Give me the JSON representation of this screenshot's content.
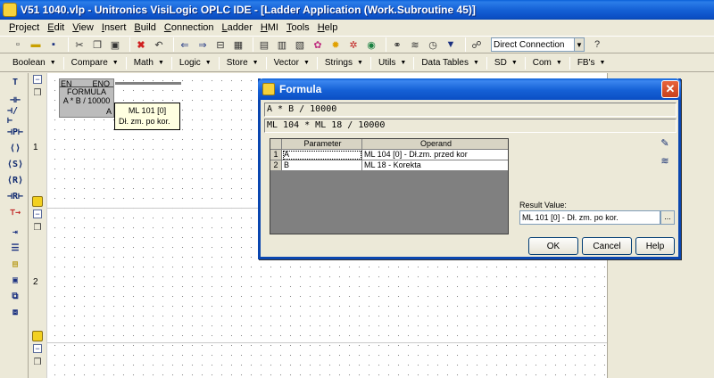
{
  "window": {
    "title": "V51 1040.vlp - Unitronics VisiLogic OPLC IDE - [Ladder Application (Work.Subroutine 45)]"
  },
  "menu": [
    "Project",
    "Edit",
    "View",
    "Insert",
    "Build",
    "Connection",
    "Ladder",
    "HMI",
    "Tools",
    "Help"
  ],
  "toolbar": {
    "connection": "Direct Connection"
  },
  "categories": [
    "Boolean",
    "Compare",
    "Math",
    "Logic",
    "Store",
    "Vector",
    "Strings",
    "Utils",
    "Data Tables",
    "SD",
    "Com",
    "FB's"
  ],
  "left_tools": [
    "T",
    "⊣⊢",
    "⊣/⊢",
    "⊣P⊢",
    "⟨⟩",
    "⟨S⟩",
    "⟨R⟩",
    "⊣R⊢",
    "⊤→"
  ],
  "rungs": {
    "one": "1",
    "two": "2"
  },
  "function_block": {
    "en": "EN",
    "eno": "ENO",
    "name": "FORMULA",
    "formula": "A * B / 10000",
    "output_label": "A"
  },
  "tooltip": {
    "line1": "ML 101 [0]",
    "line2": "Dł. zm. po kor."
  },
  "dialog": {
    "title": "Formula",
    "formula": "A * B / 10000",
    "resolved": "ML 104 * ML 18 / 10000",
    "grid_headers": {
      "parameter": "Parameter",
      "operand": "Operand"
    },
    "rows": [
      {
        "num": "1",
        "param": "A",
        "operand": "ML 104 [0] - Dł.zm. przed kor"
      },
      {
        "num": "2",
        "param": "B",
        "operand": "ML 18  - Korekta"
      }
    ],
    "result_label": "Result Value:",
    "result_value": "ML 101 [0] - Dł. zm. po kor.",
    "result_browse": "...",
    "ok": "OK",
    "cancel": "Cancel",
    "help": "Help"
  }
}
